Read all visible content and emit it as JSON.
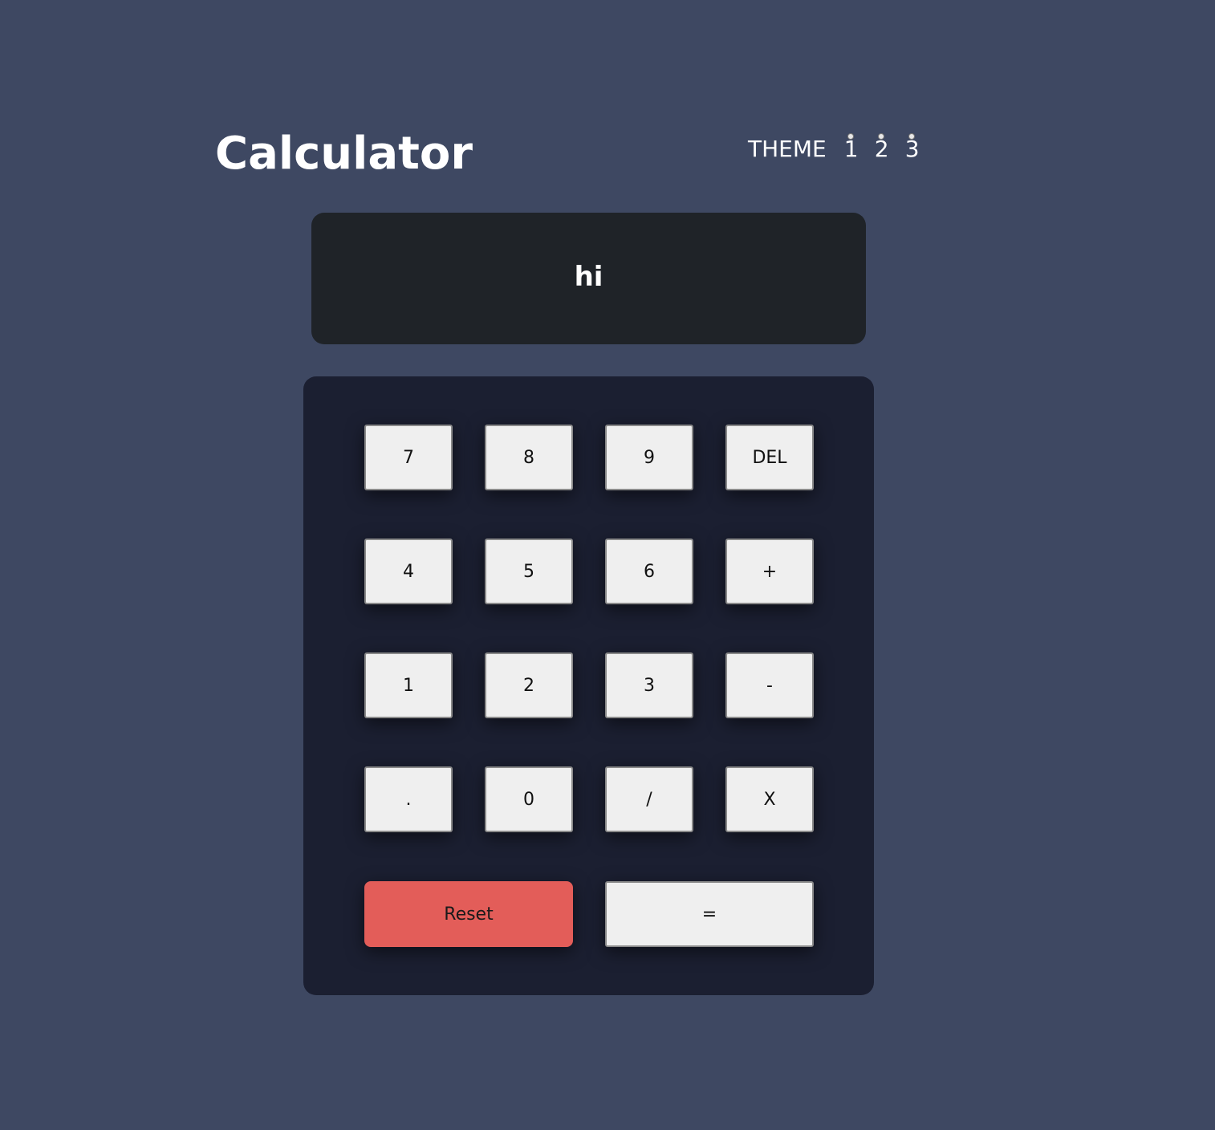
{
  "header": {
    "title": "Calculator",
    "theme_label": "THEME",
    "theme_options": [
      "1",
      "2",
      "3"
    ]
  },
  "display": {
    "value": "hi"
  },
  "keys": {
    "row1": [
      "7",
      "8",
      "9",
      "DEL"
    ],
    "row2": [
      "4",
      "5",
      "6",
      "+"
    ],
    "row3": [
      "1",
      "2",
      "3",
      "-"
    ],
    "row4": [
      ".",
      "0",
      "/",
      "X"
    ],
    "reset": "Reset",
    "equals": "="
  },
  "colors": {
    "background": "#3e4862",
    "display_bg": "#1f2328",
    "keypad_bg": "#1b1f31",
    "key_bg": "#efefef",
    "reset_bg": "#e35d59"
  }
}
